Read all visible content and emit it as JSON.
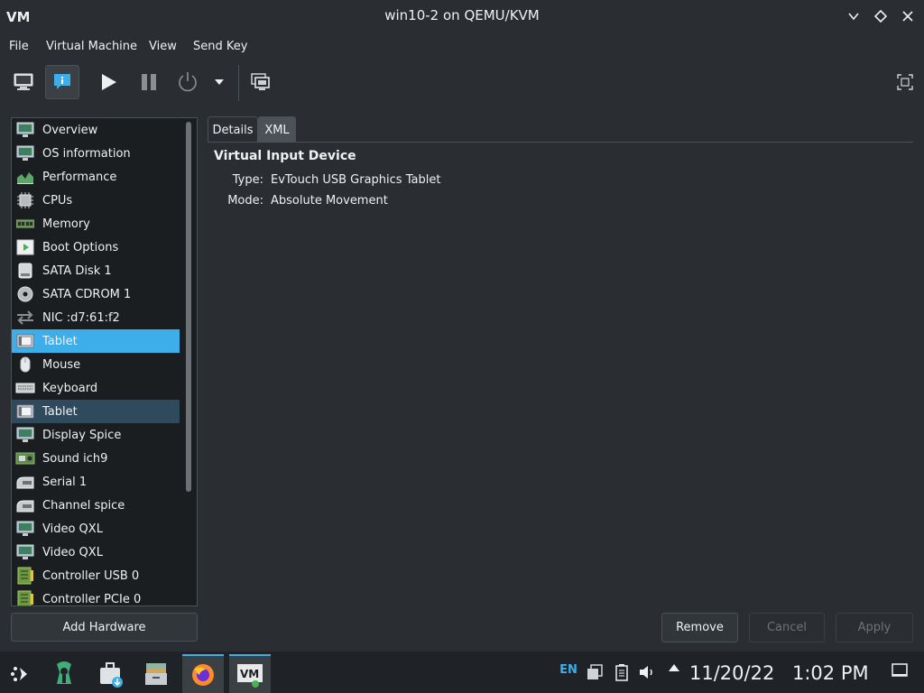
{
  "window": {
    "title": "win10-2 on QEMU/KVM"
  },
  "menu": {
    "items": [
      "File",
      "Virtual Machine",
      "View",
      "Send Key"
    ]
  },
  "hardware_list": {
    "items": [
      {
        "label": "Overview",
        "icon": "monitor-icon"
      },
      {
        "label": "OS information",
        "icon": "monitor-icon"
      },
      {
        "label": "Performance",
        "icon": "chart-icon"
      },
      {
        "label": "CPUs",
        "icon": "cpu-icon"
      },
      {
        "label": "Memory",
        "icon": "memory-icon"
      },
      {
        "label": "Boot Options",
        "icon": "boot-icon"
      },
      {
        "label": "SATA Disk 1",
        "icon": "disk-icon"
      },
      {
        "label": "SATA CDROM 1",
        "icon": "cdrom-icon"
      },
      {
        "label": "NIC :d7:61:f2",
        "icon": "network-icon"
      },
      {
        "label": "Tablet",
        "icon": "tablet-icon",
        "state": "selected"
      },
      {
        "label": "Mouse",
        "icon": "mouse-icon"
      },
      {
        "label": "Keyboard",
        "icon": "keyboard-icon"
      },
      {
        "label": "Tablet",
        "icon": "tablet-icon",
        "state": "hover"
      },
      {
        "label": "Display Spice",
        "icon": "monitor-icon"
      },
      {
        "label": "Sound ich9",
        "icon": "sound-card-icon"
      },
      {
        "label": "Serial 1",
        "icon": "serial-icon"
      },
      {
        "label": "Channel spice",
        "icon": "serial-icon"
      },
      {
        "label": "Video QXL",
        "icon": "monitor-icon"
      },
      {
        "label": "Video QXL",
        "icon": "monitor-icon"
      },
      {
        "label": "Controller USB 0",
        "icon": "controller-icon"
      },
      {
        "label": "Controller PCIe 0",
        "icon": "controller-icon"
      }
    ],
    "add_button": "Add Hardware"
  },
  "tabs": {
    "details": "Details",
    "xml": "XML"
  },
  "details": {
    "title": "Virtual Input Device",
    "type_label": "Type:",
    "type_value": "EvTouch USB Graphics Tablet",
    "mode_label": "Mode:",
    "mode_value": "Absolute Movement"
  },
  "buttons": {
    "remove": "Remove",
    "cancel": "Cancel",
    "apply": "Apply"
  },
  "taskbar": {
    "lang": "EN",
    "date": "11/20/22",
    "time": "1:02 PM"
  },
  "colors": {
    "accent": "#3daee9",
    "window_bg": "#2a2e32",
    "list_bg": "#1b1e20"
  }
}
